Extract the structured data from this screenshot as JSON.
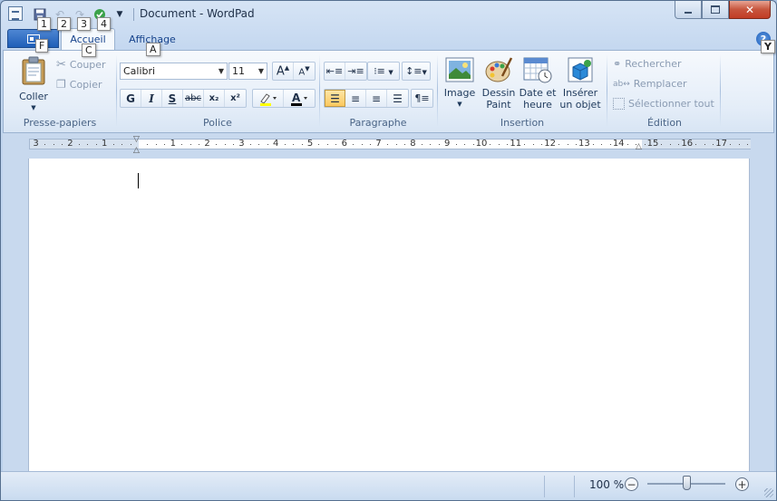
{
  "window": {
    "title": "Document - WordPad"
  },
  "quick_access": {
    "keytips": [
      "1",
      "2",
      "3",
      "4"
    ],
    "file_keytip": "F"
  },
  "tabs": {
    "home": {
      "label": "Accueil",
      "keytip": "C"
    },
    "view": {
      "label": "Affichage",
      "keytip": "A"
    },
    "help_keytip": "Y"
  },
  "clipboard": {
    "label": "Presse-papiers",
    "paste": "Coller",
    "cut": "Couper",
    "copy": "Copier"
  },
  "font": {
    "label": "Police",
    "family": "Calibri",
    "size": "11",
    "bold": "G",
    "italic": "I",
    "underline": "S",
    "strike": "abc",
    "subscript": "x₂",
    "superscript": "x²"
  },
  "paragraph": {
    "label": "Paragraphe"
  },
  "insert": {
    "label": "Insertion",
    "image": "Image",
    "paint_line1": "Dessin",
    "paint_line2": "Paint",
    "datetime_line1": "Date et",
    "datetime_line2": "heure",
    "object_line1": "Insérer",
    "object_line2": "un objet"
  },
  "editing": {
    "label": "Édition",
    "find": "Rechercher",
    "replace": "Remplacer",
    "select_all": "Sélectionner tout"
  },
  "ruler": {
    "labels": [
      "3",
      "2",
      "1",
      "",
      "1",
      "2",
      "3",
      "4",
      "5",
      "6",
      "7",
      "8",
      "9",
      "10",
      "11",
      "12",
      "13",
      "14",
      "15",
      "16",
      "17"
    ]
  },
  "status": {
    "zoom": "100 %",
    "zoom_out": "−",
    "zoom_in": "+",
    "zoom_fraction": 0.5
  },
  "colors": {
    "accent": "#1f5fb8",
    "highlight_active": "#fcc85e",
    "font_color_bar": "#000000",
    "highlighter_bar": "#ffff00"
  }
}
